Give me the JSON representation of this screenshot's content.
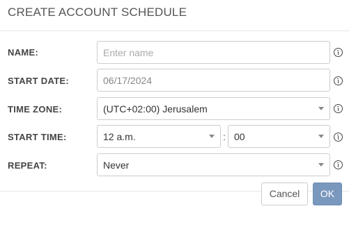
{
  "dialog": {
    "title": "CREATE ACCOUNT SCHEDULE"
  },
  "form": {
    "name": {
      "label": "NAME:",
      "placeholder": "Enter name",
      "value": ""
    },
    "start_date": {
      "label": "START DATE:",
      "value": "06/17/2024"
    },
    "time_zone": {
      "label": "TIME ZONE:",
      "value": "(UTC+02:00) Jerusalem"
    },
    "start_time": {
      "label": "START TIME:",
      "hour": "12 a.m.",
      "separator": ":",
      "minute": "00"
    },
    "repeat": {
      "label": "REPEAT:",
      "value": "Never"
    }
  },
  "footer": {
    "cancel_label": "Cancel",
    "ok_label": "OK"
  },
  "colors": {
    "primary_button": "#7a98bd",
    "border": "#cccccc",
    "placeholder": "#aaaaaa"
  },
  "icons": {
    "info": "info-circle-icon",
    "dropdown": "chevron-down-icon"
  }
}
